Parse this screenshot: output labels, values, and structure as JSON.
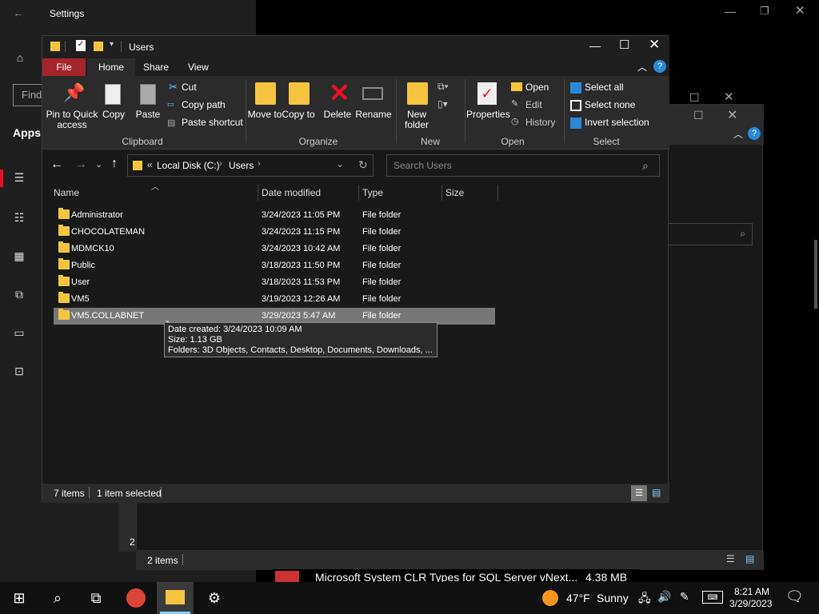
{
  "settings": {
    "title": "Settings",
    "find_placeholder": "Find",
    "apps_label": "Apps"
  },
  "bg_window": {
    "status_items": "2 items"
  },
  "explorer": {
    "title": "Users",
    "tabs": [
      "File",
      "Home",
      "Share",
      "View"
    ],
    "ribbon": {
      "pin": "Pin to Quick access",
      "copy": "Copy",
      "paste": "Paste",
      "cut": "Cut",
      "copy_path": "Copy path",
      "paste_shortcut": "Paste shortcut",
      "clipboard": "Clipboard",
      "move_to": "Move to",
      "copy_to": "Copy to",
      "delete": "Delete",
      "rename": "Rename",
      "organize": "Organize",
      "new_folder": "New folder",
      "new": "New",
      "properties": "Properties",
      "open": "Open",
      "edit": "Edit",
      "history": "History",
      "open_group": "Open",
      "select_all": "Select all",
      "select_none": "Select none",
      "invert_selection": "Invert selection",
      "select_group": "Select"
    },
    "address": {
      "prefix": "«",
      "crumb1": "Local Disk (C:)",
      "crumb2": "Users"
    },
    "search_placeholder": "Search Users",
    "columns": [
      "Name",
      "Date modified",
      "Type",
      "Size"
    ],
    "rows": [
      {
        "name": "Administrator",
        "date": "3/24/2023 11:05 PM",
        "type": "File folder"
      },
      {
        "name": "CHOCOLATEMAN",
        "date": "3/24/2023 11:15 PM",
        "type": "File folder"
      },
      {
        "name": "MDMCK10",
        "date": "3/24/2023 10:42 AM",
        "type": "File folder"
      },
      {
        "name": "Public",
        "date": "3/18/2023 11:50 PM",
        "type": "File folder"
      },
      {
        "name": "User",
        "date": "3/18/2023 11:53 PM",
        "type": "File folder"
      },
      {
        "name": "VM5",
        "date": "3/19/2023 12:26 AM",
        "type": "File folder"
      },
      {
        "name": "VM5.COLLABNET",
        "date": "3/29/2023 5:47 AM",
        "type": "File folder"
      }
    ],
    "status_items": "7 items",
    "status_selected": "1 item selected"
  },
  "tooltip": {
    "line1": "Date created: 3/24/2023 10:09 AM",
    "line2": "Size: 1.13 GB",
    "line3": "Folders: 3D Objects, Contacts, Desktop, Documents, Downloads, ..."
  },
  "partial_row": {
    "name": "Microsoft System CLR Types for SQL Server vNext...",
    "size": "4.38 MB"
  },
  "taskbar": {
    "weather_temp": "47°F",
    "weather_text": "Sunny",
    "time": "8:21 AM",
    "date": "3/29/2023"
  },
  "colors": {
    "file_tab": "#a4262c",
    "folder": "#f5c542",
    "selection": "#777777",
    "delete_red": "#e81123"
  }
}
